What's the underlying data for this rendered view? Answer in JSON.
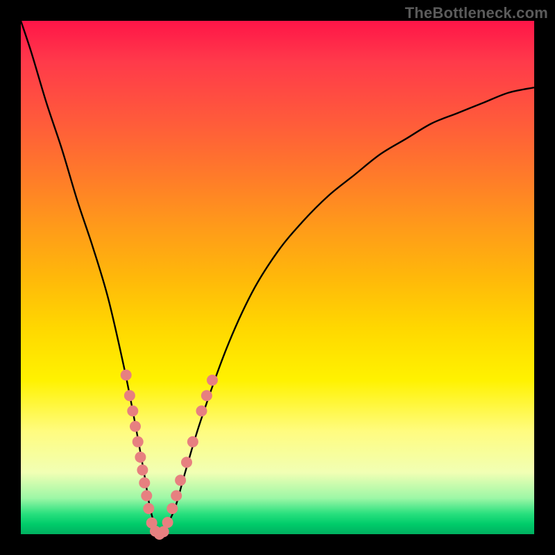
{
  "watermark": "TheBottleneck.com",
  "colors": {
    "background": "#000000",
    "gradient_top": "#ff1548",
    "gradient_bottom": "#00b060",
    "curve": "#000000",
    "marker": "#e78080"
  },
  "chart_data": {
    "type": "line",
    "title": "",
    "xlabel": "",
    "ylabel": "",
    "xlim": [
      0,
      100
    ],
    "ylim": [
      0,
      100
    ],
    "series": [
      {
        "name": "bottleneck-curve",
        "x": [
          0,
          2,
          5,
          8,
          11,
          14,
          17,
          20,
          22,
          24,
          25,
          26,
          27,
          28,
          30,
          32,
          35,
          40,
          45,
          50,
          55,
          60,
          65,
          70,
          75,
          80,
          85,
          90,
          95,
          100
        ],
        "y": [
          100,
          94,
          84,
          75,
          65,
          56,
          46,
          33,
          23,
          12,
          6,
          2,
          0,
          1,
          5,
          12,
          22,
          36,
          47,
          55,
          61,
          66,
          70,
          74,
          77,
          80,
          82,
          84,
          86,
          87
        ]
      }
    ],
    "markers": [
      {
        "x": 20.5,
        "y": 31
      },
      {
        "x": 21.2,
        "y": 27
      },
      {
        "x": 21.8,
        "y": 24
      },
      {
        "x": 22.3,
        "y": 21
      },
      {
        "x": 22.8,
        "y": 18
      },
      {
        "x": 23.3,
        "y": 15
      },
      {
        "x": 23.7,
        "y": 12.5
      },
      {
        "x": 24.1,
        "y": 10
      },
      {
        "x": 24.5,
        "y": 7.5
      },
      {
        "x": 24.9,
        "y": 5
      },
      {
        "x": 25.5,
        "y": 2.2
      },
      {
        "x": 26.2,
        "y": 0.6
      },
      {
        "x": 27.0,
        "y": 0.0
      },
      {
        "x": 27.8,
        "y": 0.5
      },
      {
        "x": 28.6,
        "y": 2.3
      },
      {
        "x": 29.5,
        "y": 5
      },
      {
        "x": 30.3,
        "y": 7.5
      },
      {
        "x": 31.1,
        "y": 10.5
      },
      {
        "x": 32.3,
        "y": 14
      },
      {
        "x": 33.5,
        "y": 18
      },
      {
        "x": 35.2,
        "y": 24
      },
      {
        "x": 36.2,
        "y": 27
      },
      {
        "x": 37.3,
        "y": 30
      }
    ]
  }
}
